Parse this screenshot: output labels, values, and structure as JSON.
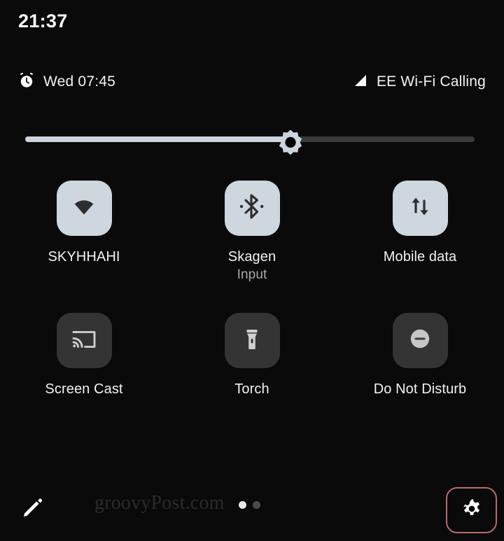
{
  "statusbar": {
    "clock": "21:37",
    "alarm_icon": "alarm-clock-icon",
    "alarm_text": "Wed 07:45",
    "signal_icon": "signal-triangle-icon",
    "carrier_text": "EE Wi-Fi Calling"
  },
  "brightness": {
    "name": "brightness-slider",
    "value_percent": 59,
    "thumb_icon": "brightness-sun-icon",
    "fill_color": "#ccd4dd",
    "track_color": "#3a3a3a"
  },
  "tiles": {
    "active_bg": "#ced6de",
    "inactive_bg": "#343434",
    "rows": [
      [
        {
          "name": "tile-wifi",
          "icon": "wifi-icon",
          "label": "SKYHHAHI",
          "sublabel": "",
          "state": "on"
        },
        {
          "name": "tile-bluetooth",
          "icon": "bluetooth-icon",
          "label": "Skagen",
          "sublabel": "Input",
          "state": "on"
        },
        {
          "name": "tile-mobile-data",
          "icon": "mobile-data-arrows-icon",
          "label": "Mobile data",
          "sublabel": "",
          "state": "on"
        }
      ],
      [
        {
          "name": "tile-screen-cast",
          "icon": "screen-cast-icon",
          "label": "Screen Cast",
          "sublabel": "",
          "state": "off"
        },
        {
          "name": "tile-torch",
          "icon": "flashlight-icon",
          "label": "Torch",
          "sublabel": "",
          "state": "off"
        },
        {
          "name": "tile-do-not-disturb",
          "icon": "do-not-disturb-icon",
          "label": "Do Not Disturb",
          "sublabel": "",
          "state": "off"
        }
      ]
    ]
  },
  "footer": {
    "edit_icon": "pencil-edit-icon",
    "watermark": "groovyPost.com",
    "pages": {
      "count": 2,
      "current": 1
    },
    "settings_icon": "gear-icon",
    "settings_highlight_color": "#b86a6a"
  }
}
